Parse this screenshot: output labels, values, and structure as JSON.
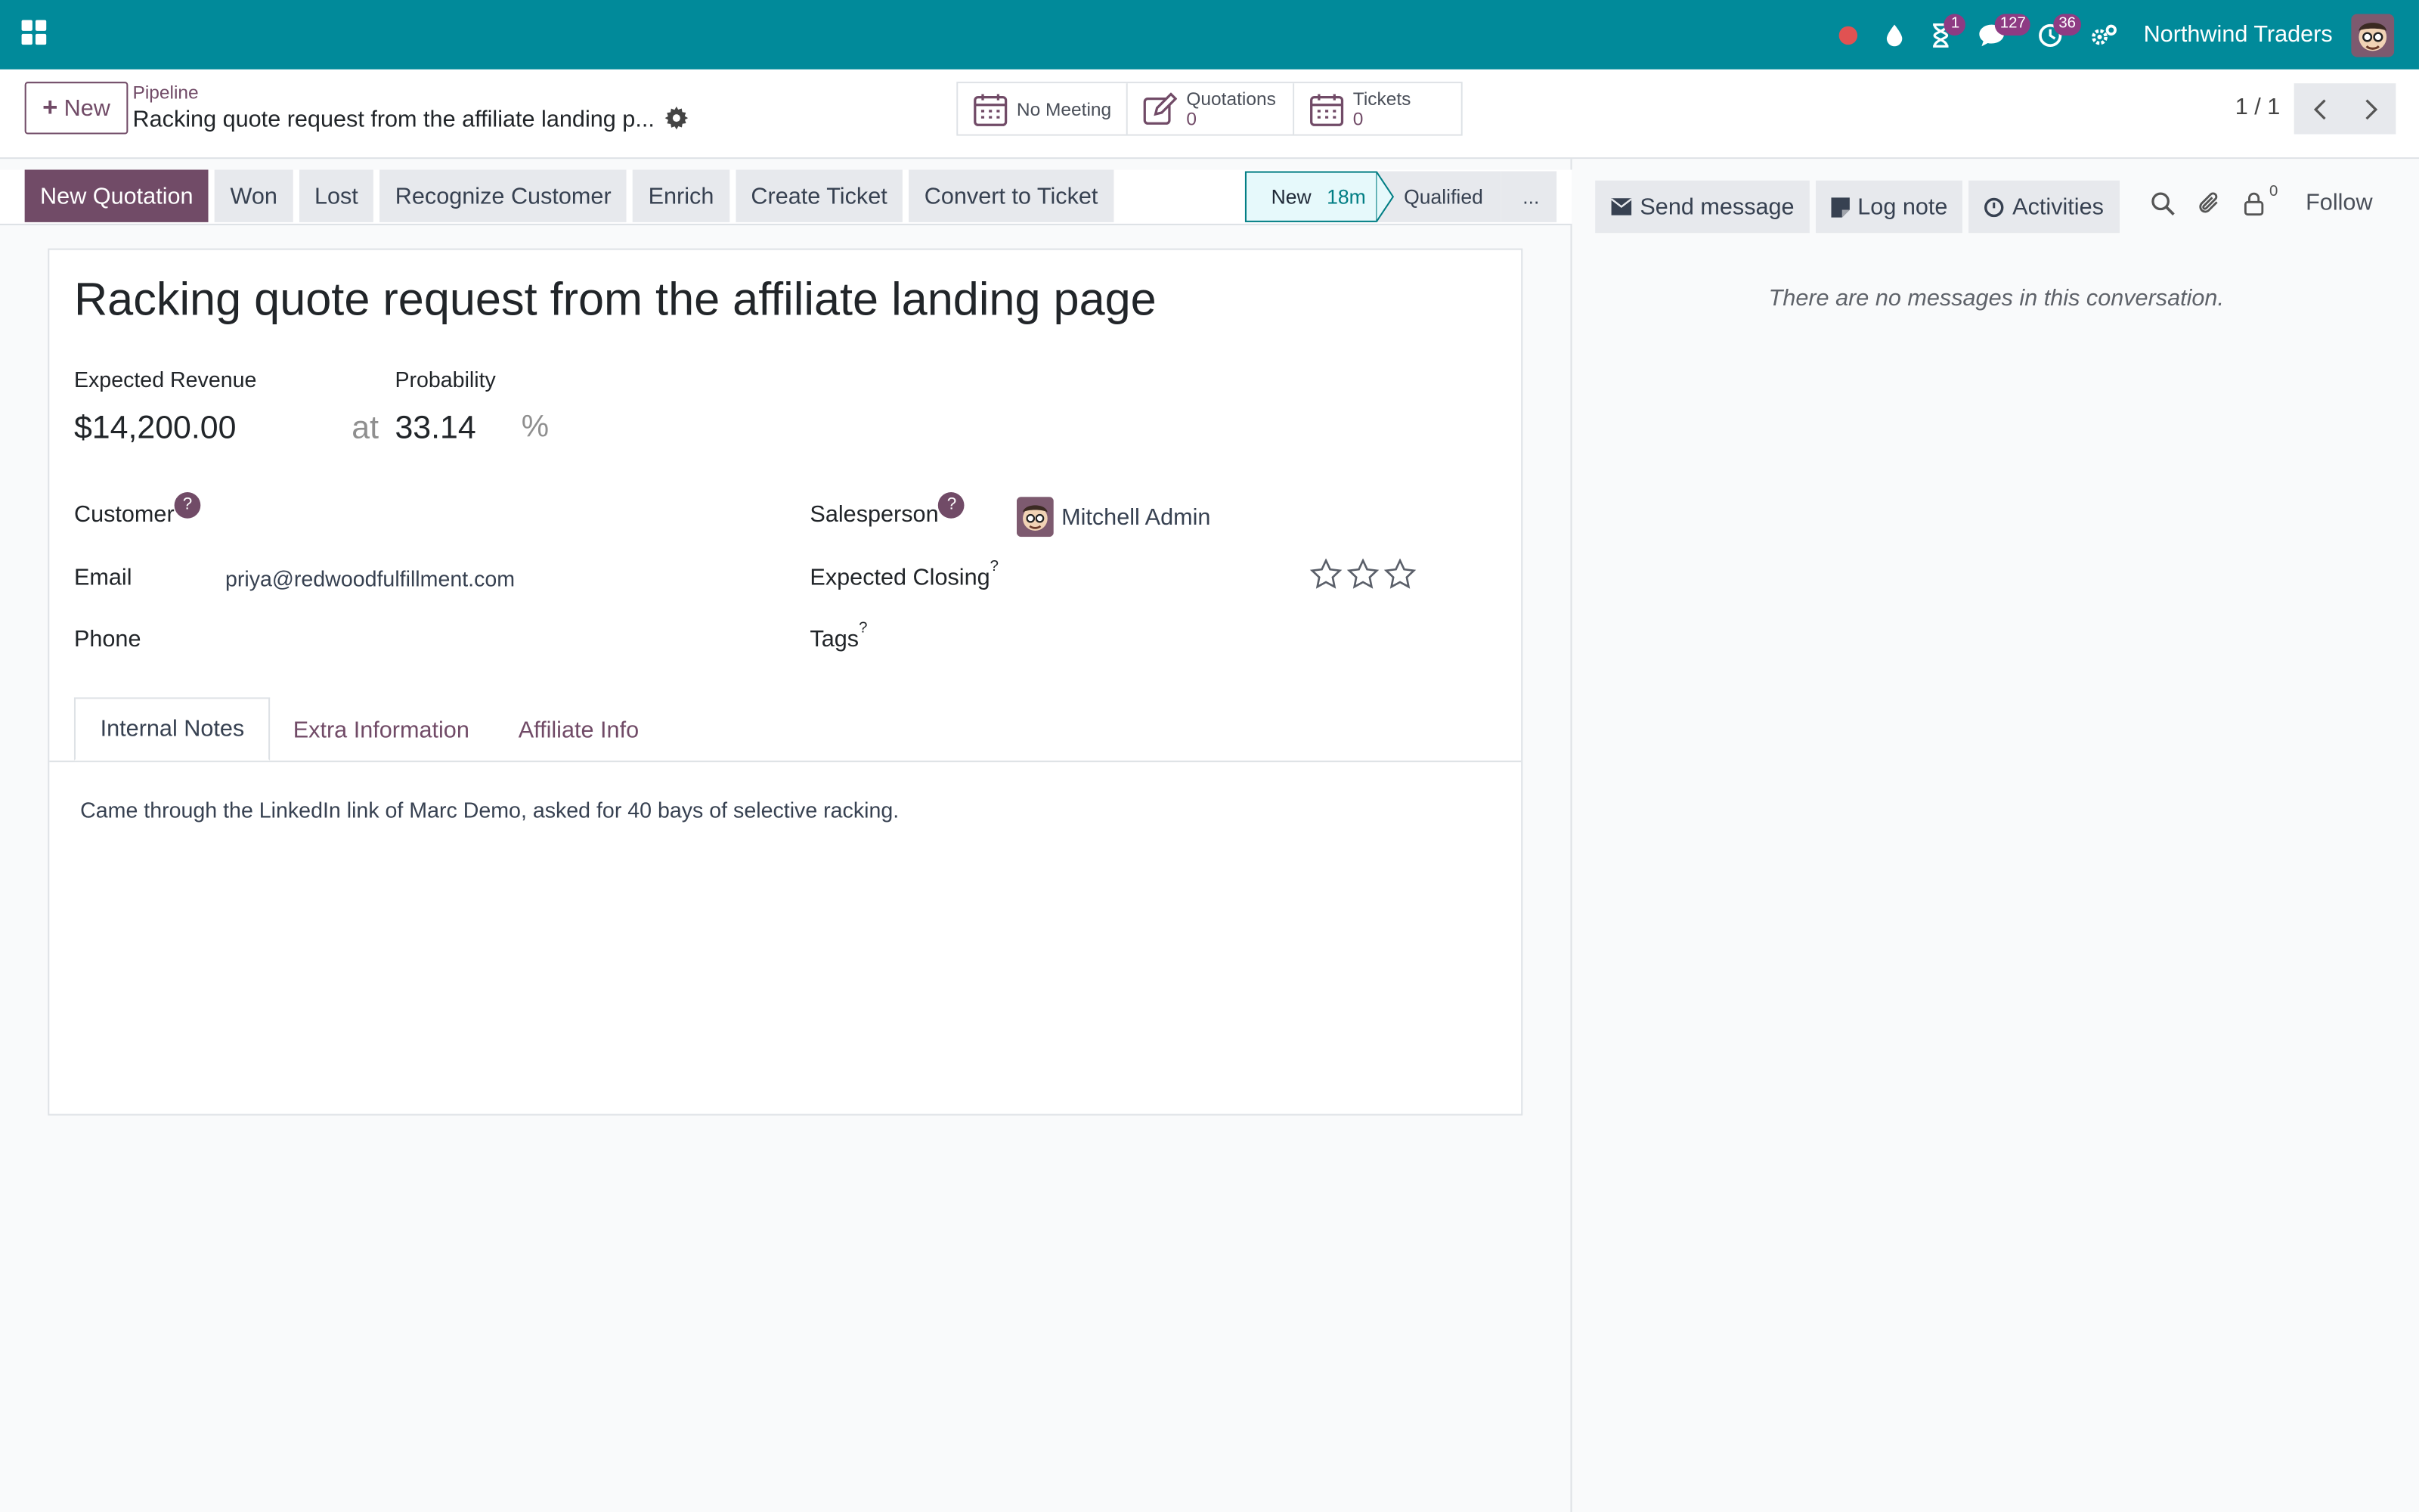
{
  "navbar": {
    "company": "Northwind Traders",
    "badges": {
      "activities": "1",
      "messages": "127",
      "clock": "36"
    },
    "colors": {
      "bar": "#018a9a",
      "badge": "#8e3b83"
    }
  },
  "control_panel": {
    "new_label": "New",
    "breadcrumb": "Pipeline",
    "record_title": "Racking quote request from the affiliate landing p...",
    "smart_buttons": {
      "meeting": "No Meeting",
      "quotations_label": "Quotations",
      "quotations_count": "0",
      "tickets_label": "Tickets",
      "tickets_count": "0"
    },
    "pager": "1 / 1"
  },
  "statusbar": {
    "actions": {
      "new_quotation": "New Quotation",
      "won": "Won",
      "lost": "Lost",
      "recognize": "Recognize Customer",
      "enrich": "Enrich",
      "create_ticket": "Create Ticket",
      "convert_ticket": "Convert to Ticket"
    },
    "stages": {
      "current": "New",
      "current_duration": "18m",
      "next": "Qualified",
      "more": "..."
    }
  },
  "form": {
    "title": "Racking quote request from the affiliate landing page",
    "expected_revenue_label": "Expected Revenue",
    "probability_label": "Probability",
    "expected_revenue": "$14,200.00",
    "at": "at",
    "probability": "33.14",
    "percent": "%",
    "customer_label": "Customer",
    "email_label": "Email",
    "email": "priya@redwoodfulfillment.com",
    "phone_label": "Phone",
    "salesperson_label": "Salesperson",
    "salesperson": "Mitchell Admin",
    "expected_closing_label": "Expected Closing",
    "tags_label": "Tags",
    "help_mark": "?",
    "priority_stars": 0,
    "tabs": {
      "internal_notes": "Internal Notes",
      "extra_info": "Extra Information",
      "affiliate_info": "Affiliate Info"
    },
    "notes": "Came through the LinkedIn link of Marc Demo, asked for 40 bays of selective racking."
  },
  "chatter": {
    "send_message": "Send message",
    "log_note": "Log note",
    "activities": "Activities",
    "followers_count": "0",
    "follow": "Follow",
    "empty": "There are no messages in this conversation."
  }
}
